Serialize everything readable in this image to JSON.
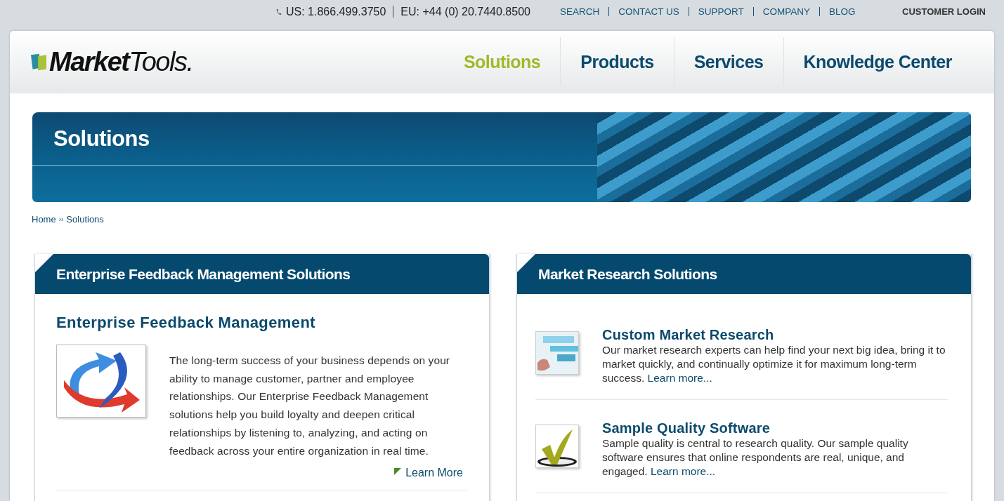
{
  "top_bar": {
    "phones": [
      "US: 1.866.499.3750",
      "EU: +44 (0) 20.7440.8500"
    ],
    "links": [
      "SEARCH",
      "CONTACT US",
      "SUPPORT",
      "COMPANY",
      "BLOG"
    ],
    "login": "CUSTOMER LOGIN"
  },
  "logo": "**Market**Tools.",
  "nav": [
    {
      "label": "Solutions",
      "selected": true
    },
    {
      "label": "Products",
      "selected": false
    },
    {
      "label": "Services",
      "selected": false
    },
    {
      "label": "Knowledge Center",
      "selected": false
    }
  ],
  "hero": {
    "title": "Solutions"
  },
  "breadcrumb": [
    "Home",
    "Solutions"
  ],
  "breadcrumb_separator": "››",
  "panels": [
    {
      "title": "Enterprise Feedback Management Solutions",
      "kind": "feature",
      "heading": "Enterprise Feedback Management",
      "text": "The long-term success of your business depends on your ability to manage customer, partner and employee relationships.  Our Enterprise Feedback Management solutions help you build loyalty and deepen critical relationships by listening to, analyzing, and acting on feedback across your entire organization in real time.",
      "link": "Learn More"
    },
    {
      "title": "Market Research Solutions",
      "kind": "list",
      "items": [
        {
          "heading": "Custom Market Research",
          "text": "Our market research experts can help find your next big idea, bring it to market quickly, and continually optimize it for maximum long-term success.",
          "link": "Learn more..."
        },
        {
          "heading": "Sample Quality Software",
          "text": "Sample quality is central to research quality.  Our sample quality software ensures that online respondents are real, unique, and engaged.",
          "link": "Learn more..."
        }
      ]
    }
  ]
}
